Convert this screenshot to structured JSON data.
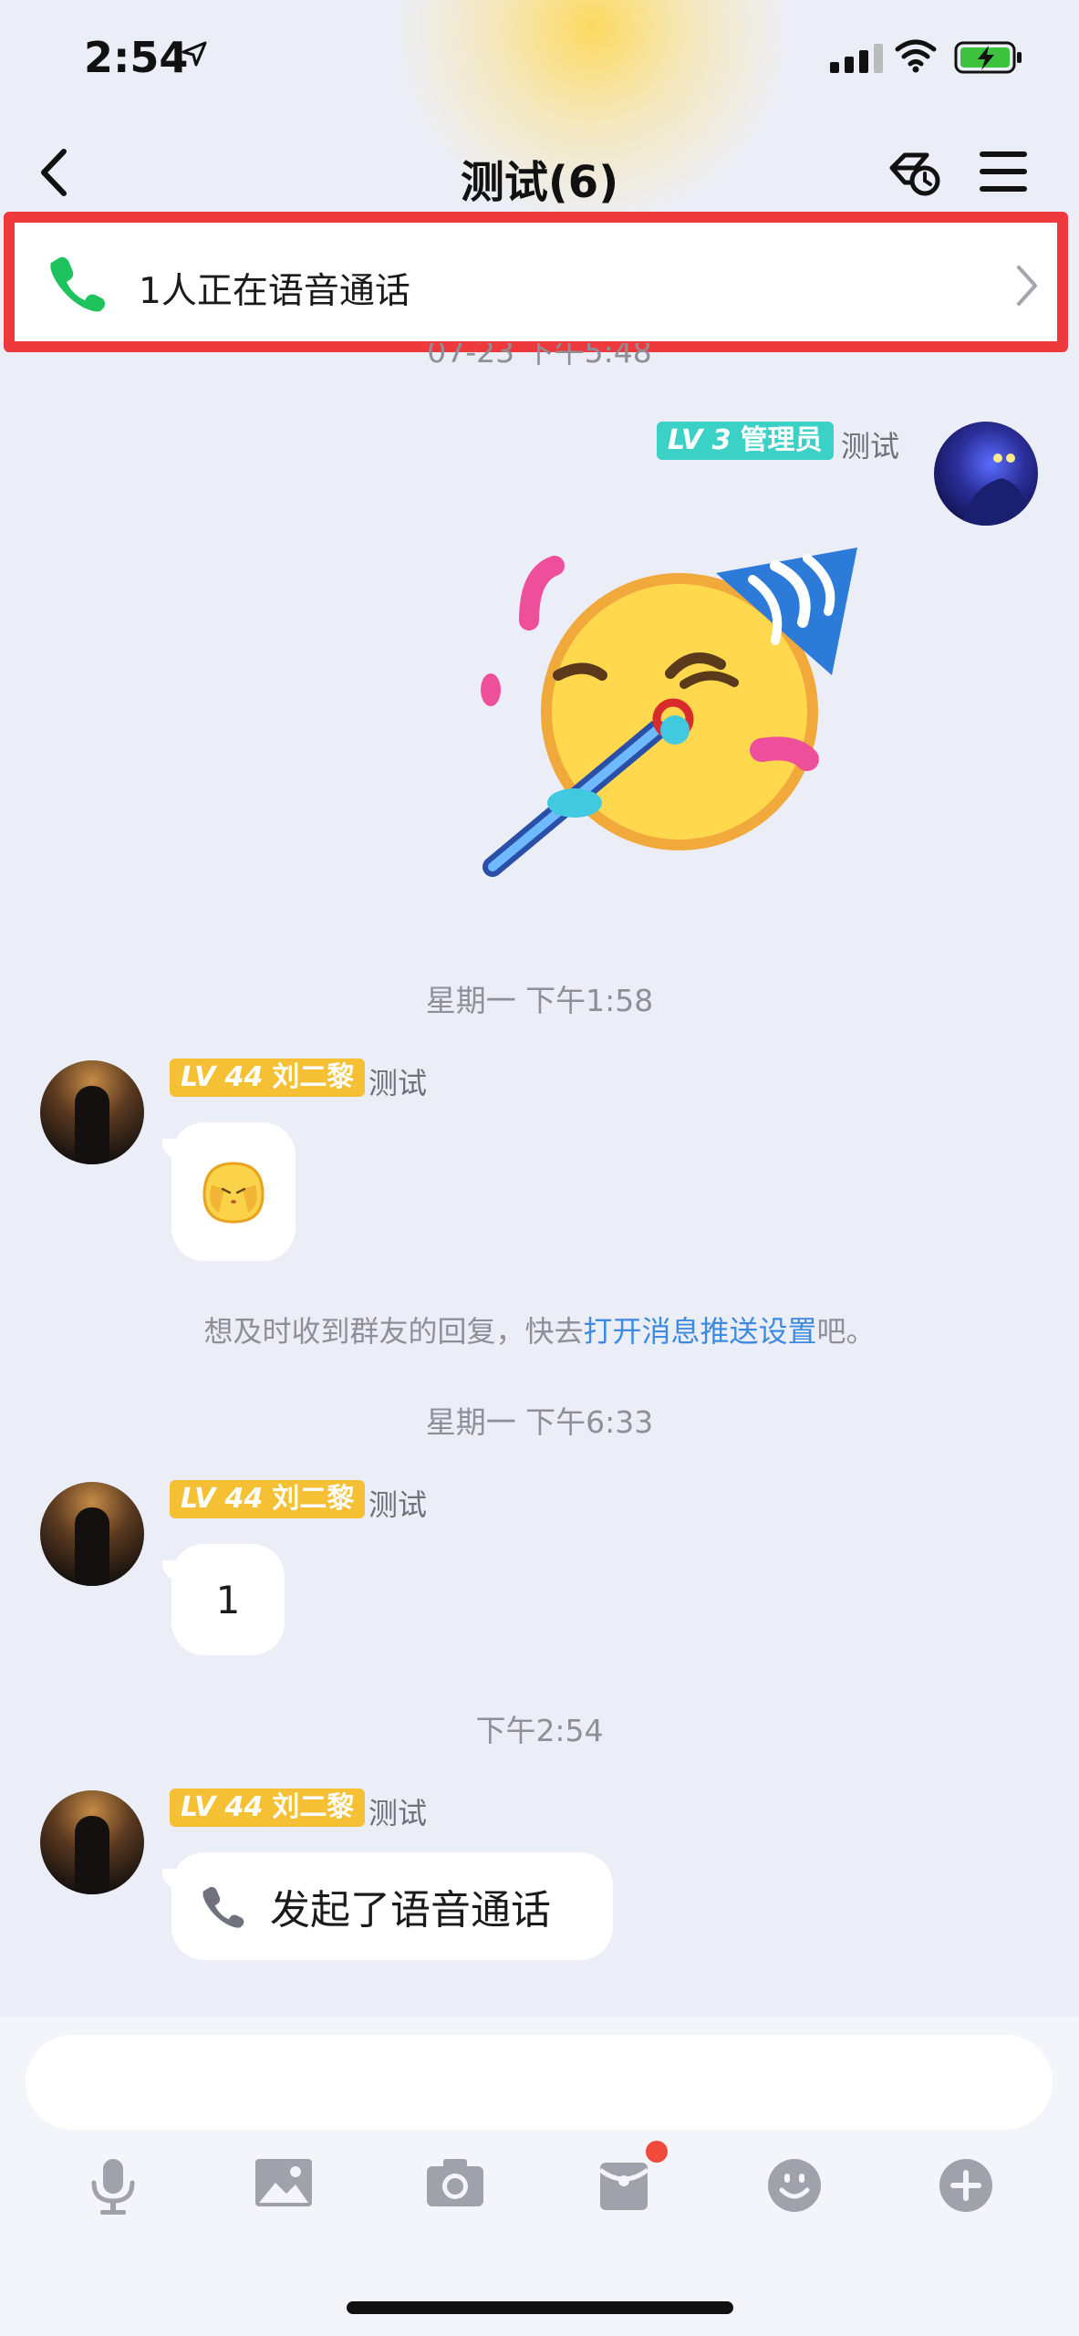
{
  "status_bar": {
    "time": "2:54"
  },
  "nav": {
    "title": "测试(6)"
  },
  "call_banner": {
    "text": "1人正在语音通话"
  },
  "messages": [
    {
      "timestamp": "07-23 下午5:48"
    },
    {
      "level_prefix": "LV",
      "level": "3",
      "role": "管理员",
      "name": "测试"
    },
    {
      "timestamp": "星期一 下午1:58"
    },
    {
      "level_prefix": "LV",
      "level": "44",
      "nickname": "刘二黎",
      "name": "测试"
    },
    {
      "notice_before": "想及时收到群友的回复，快去",
      "notice_link": "打开消息推送设置",
      "notice_after": "吧。"
    },
    {
      "timestamp": "星期一 下午6:33"
    },
    {
      "level_prefix": "LV",
      "level": "44",
      "nickname": "刘二黎",
      "name": "测试",
      "text": "1"
    },
    {
      "timestamp": "下午2:54"
    },
    {
      "level_prefix": "LV",
      "level": "44",
      "nickname": "刘二黎",
      "name": "测试",
      "text": "发起了语音通话"
    }
  ],
  "toolbar": {
    "items": [
      "microphone-icon",
      "image-icon",
      "camera-icon",
      "red-packet-icon",
      "emoji-icon",
      "plus-icon"
    ],
    "notification_dot_color": "#f04a3a"
  },
  "colors": {
    "banner_border": "#ee3a3d",
    "admin_badge": "#3bd1c6",
    "user_badge": "#f5c033",
    "link": "#3d8be0",
    "call_green": "#1fc35d"
  }
}
